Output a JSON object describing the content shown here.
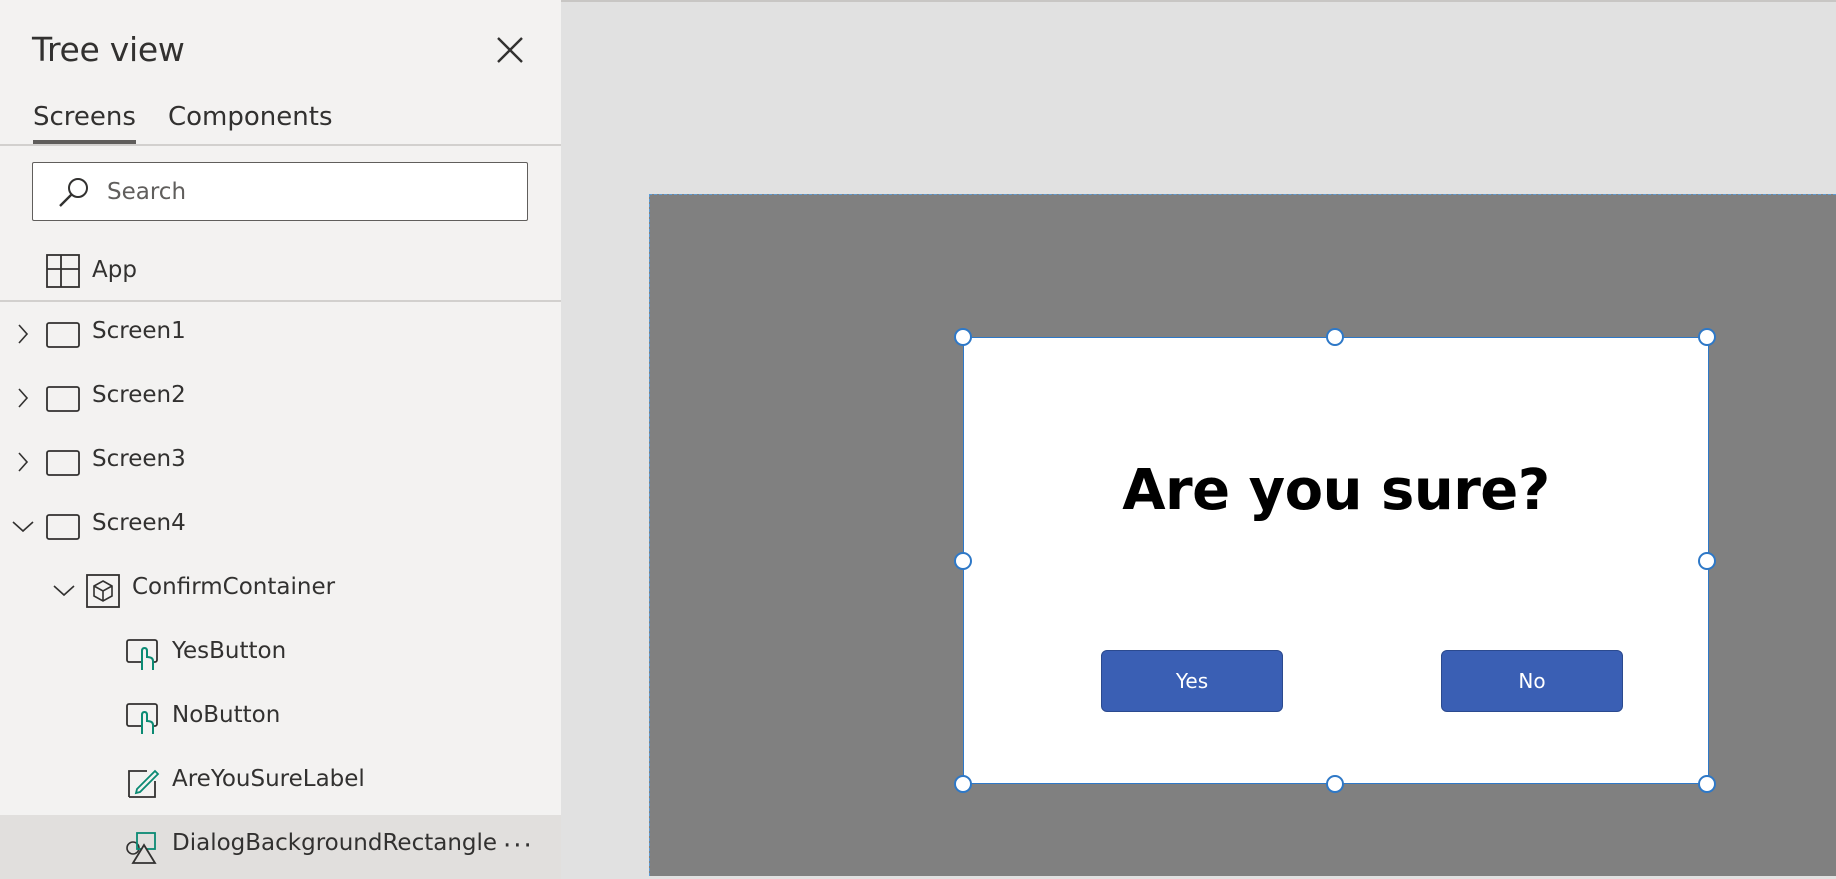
{
  "panel": {
    "title": "Tree view",
    "tabs": [
      {
        "label": "Screens",
        "active": true
      },
      {
        "label": "Components",
        "active": false
      }
    ],
    "search": {
      "placeholder": "Search",
      "value": ""
    },
    "app": {
      "label": "App",
      "icon": "app-icon"
    },
    "tree": [
      {
        "label": "Screen1",
        "icon": "screen-icon",
        "expanded": false
      },
      {
        "label": "Screen2",
        "icon": "screen-icon",
        "expanded": false
      },
      {
        "label": "Screen3",
        "icon": "screen-icon",
        "expanded": false
      },
      {
        "label": "Screen4",
        "icon": "screen-icon",
        "expanded": true
      },
      {
        "label": "ConfirmContainer",
        "icon": "container-icon",
        "expanded": true
      },
      {
        "label": "YesButton",
        "icon": "button-icon"
      },
      {
        "label": "NoButton",
        "icon": "button-icon"
      },
      {
        "label": "AreYouSureLabel",
        "icon": "label-icon"
      },
      {
        "label": "DialogBackgroundRectangle",
        "icon": "shapes-icon",
        "selected": true
      }
    ],
    "more_label": "···"
  },
  "canvas": {
    "dialog": {
      "title": "Are you sure?",
      "yes_label": "Yes",
      "no_label": "No"
    }
  },
  "colors": {
    "panel_bg": "#f3f2f1",
    "canvas_bg": "#e1e1e1",
    "screen_bg": "#808080",
    "button_bg": "#3a5fb4",
    "selection": "#2e78c7"
  }
}
